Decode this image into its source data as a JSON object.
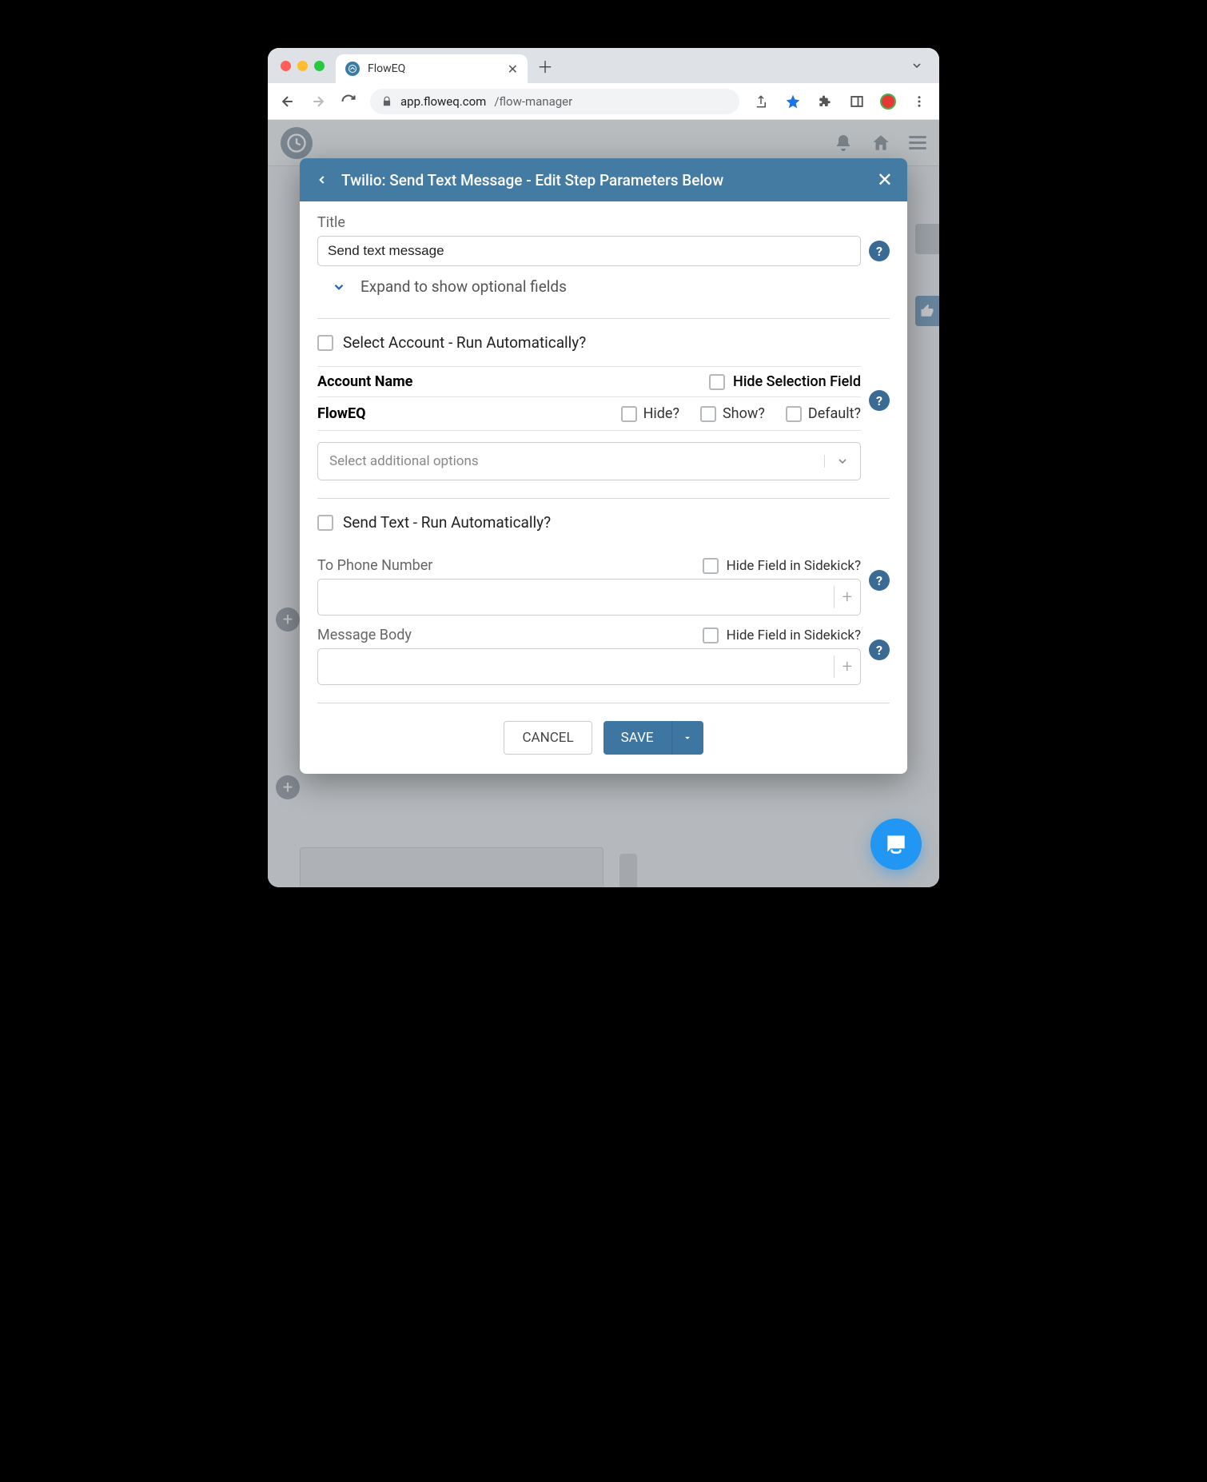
{
  "browser": {
    "tab_title": "FlowEQ",
    "url_host": "app.floweq.com",
    "url_path": "/flow-manager"
  },
  "modal": {
    "header": "Twilio: Send Text Message - Edit Step Parameters Below",
    "title_label": "Title",
    "title_value": "Send text message",
    "expand_label": "Expand to show optional fields",
    "section1": {
      "run_auto_label": "Select Account - Run Automatically?",
      "account_name_header": "Account Name",
      "hide_selection_label": "Hide Selection Field",
      "account_value": "FlowEQ",
      "hide_label": "Hide?",
      "show_label": "Show?",
      "default_label": "Default?",
      "select_placeholder": "Select additional options"
    },
    "section2": {
      "run_auto_label": "Send Text - Run Automatically?",
      "phone_label": "To Phone Number",
      "hide_field_label": "Hide Field in Sidekick?",
      "body_label": "Message Body"
    },
    "footer": {
      "cancel": "CANCEL",
      "save": "SAVE"
    }
  }
}
